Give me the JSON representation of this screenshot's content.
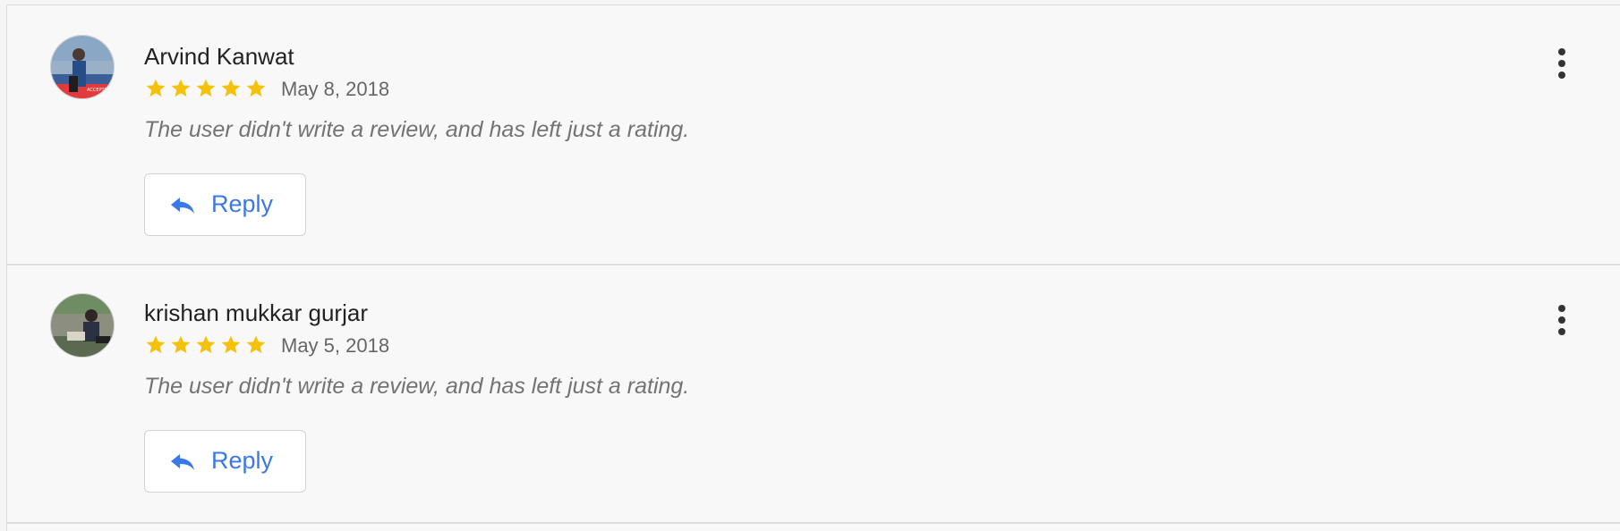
{
  "reviews": [
    {
      "name": "Arvind Kanwat",
      "rating": 5,
      "date": "May 8, 2018",
      "text": "The user didn't write a review, and has left just a rating.",
      "reply_label": "Reply",
      "avatar_colors": {
        "sky": "#8aa7c6",
        "ground": "#3c5f9a",
        "band": "#e33b3b",
        "figure": "#254d8a"
      }
    },
    {
      "name": "krishan mukkar gurjar",
      "rating": 5,
      "date": "May 5, 2018",
      "text": "The user didn't write a review, and has left just a rating.",
      "reply_label": "Reply",
      "avatar_colors": {
        "sky": "#b7b49d",
        "ground": "#5a6950",
        "band": "#8c8e80",
        "figure": "#2b3142"
      }
    }
  ],
  "colors": {
    "star": "#f4c20d",
    "reply_text": "#3b78e7",
    "review_text": "#737373",
    "name_text": "#222222"
  },
  "icons": {
    "star": "star-icon",
    "reply": "reply-icon",
    "more": "more-vertical-icon"
  }
}
